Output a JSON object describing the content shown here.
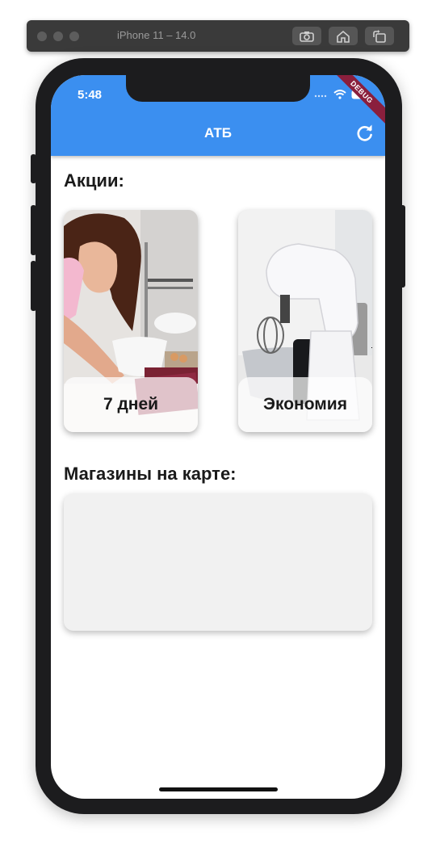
{
  "simulator": {
    "title": "iPhone 11 – 14.0",
    "buttons": [
      "screenshot-icon",
      "home-icon",
      "rotate-icon"
    ]
  },
  "status_bar": {
    "time": "5:48",
    "debug_label": "DEBUG"
  },
  "app_bar": {
    "title": "АТБ",
    "action_icon": "refresh-icon"
  },
  "promotions": {
    "title": "Акции:",
    "items": [
      {
        "label": "7 дней",
        "image": "woman-baking-photo"
      },
      {
        "label": "Экономия",
        "image": "stand-mixer-photo"
      }
    ]
  },
  "stores": {
    "title": "Магазины на карте:"
  },
  "colors": {
    "accent": "#3b8ff0",
    "map_placeholder": "#f1f1f1"
  }
}
